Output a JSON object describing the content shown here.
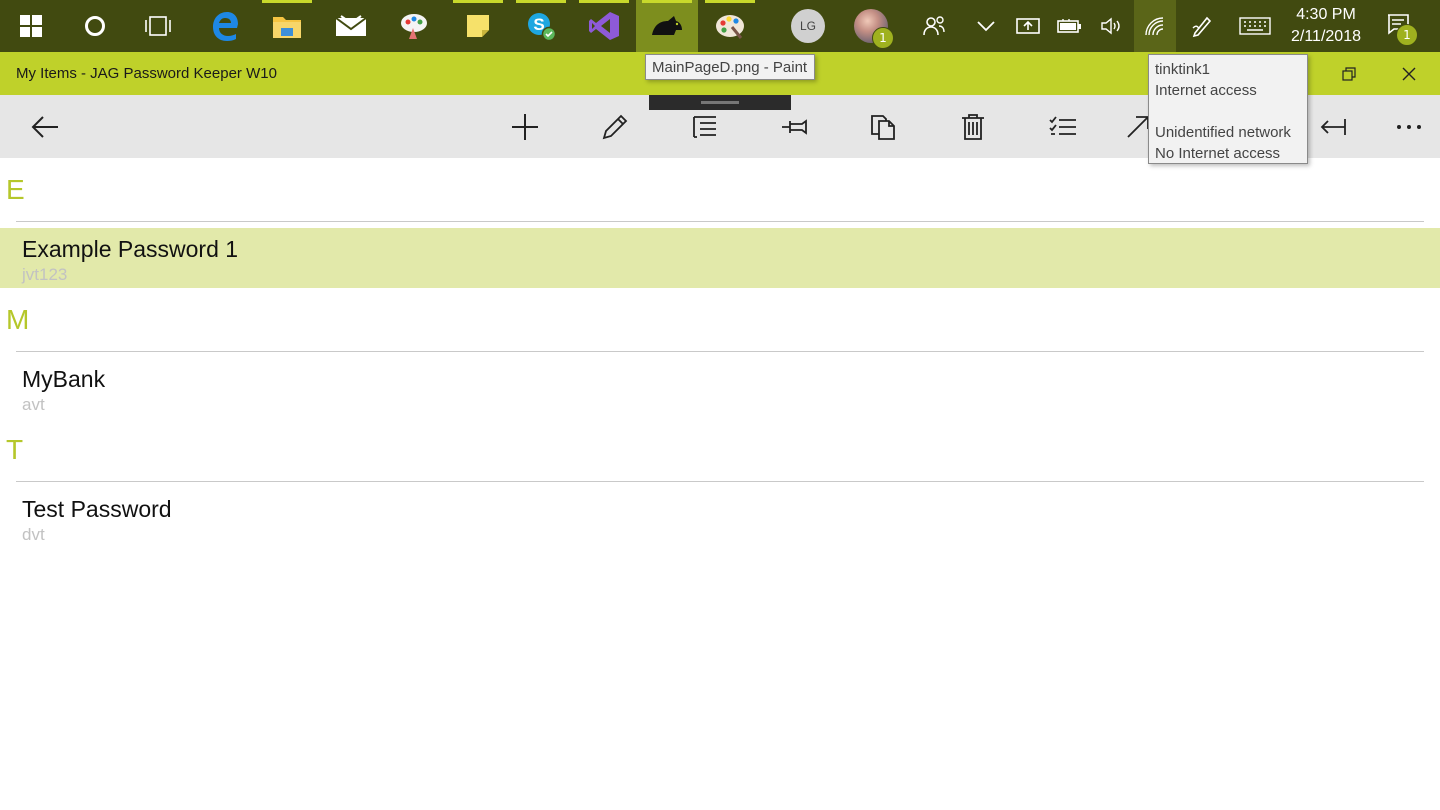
{
  "taskbar": {
    "icons": [
      {
        "name": "windows-start-icon"
      },
      {
        "name": "cortana-icon"
      },
      {
        "name": "task-view-icon"
      },
      {
        "name": "edge-icon"
      },
      {
        "name": "file-explorer-icon"
      },
      {
        "name": "mail-icon"
      },
      {
        "name": "paint-3d-icon"
      },
      {
        "name": "sticky-notes-icon"
      },
      {
        "name": "skype-icon"
      },
      {
        "name": "visual-studio-icon"
      },
      {
        "name": "jag-password-keeper-icon"
      },
      {
        "name": "paint-icon"
      }
    ],
    "people": [
      {
        "initials": "LG"
      },
      {
        "badge": "1"
      }
    ],
    "clock": {
      "time": "4:30 PM",
      "date": "2/11/2018"
    },
    "notifications_badge": "1",
    "accent": "#414a10"
  },
  "tooltips": {
    "paint": "MainPageD.png - Paint",
    "network": {
      "line1": "tinktink1",
      "line2": "Internet access",
      "line3": "",
      "line4": "Unidentified network",
      "line5": "No Internet access"
    }
  },
  "window": {
    "title": "My Items - JAG Password Keeper W10",
    "title_color": "#bfd12a"
  },
  "commandbar": {
    "buttons": [
      "back",
      "add",
      "edit",
      "list",
      "pin",
      "copy",
      "delete",
      "select",
      "open",
      "sign-out",
      "more"
    ]
  },
  "groups": [
    {
      "letter": "E",
      "items": [
        {
          "title": "Example Password 1",
          "subtitle": "jvt123",
          "selected": true
        }
      ]
    },
    {
      "letter": "M",
      "items": [
        {
          "title": "MyBank",
          "subtitle": "avt",
          "selected": false
        }
      ]
    },
    {
      "letter": "T",
      "items": [
        {
          "title": "Test Password",
          "subtitle": "dvt",
          "selected": false
        }
      ]
    }
  ]
}
